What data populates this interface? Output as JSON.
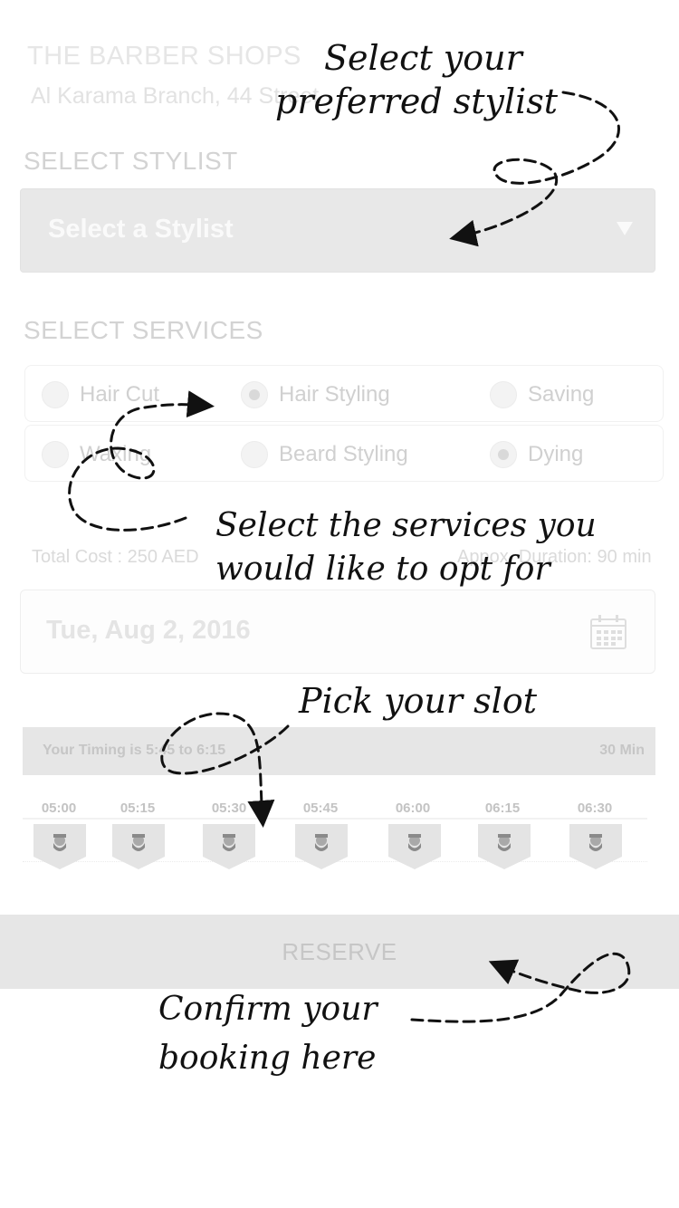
{
  "shop": {
    "title": "THE BARBER SHOPS",
    "branch": "Al Karama Branch, 44 Street"
  },
  "stylist": {
    "section_label": "SELECT STYLIST",
    "placeholder": "Select a Stylist",
    "caret_icon": "dropdown-caret-icon"
  },
  "services": {
    "section_label": "SELECT SERVICES",
    "rows": [
      [
        {
          "label": "Hair Cut",
          "selected": false
        },
        {
          "label": "Hair Styling",
          "selected": true
        },
        {
          "label": "Saving",
          "selected": false
        }
      ],
      [
        {
          "label": "Waxing",
          "selected": false
        },
        {
          "label": "Beard Styling",
          "selected": false
        },
        {
          "label": "Dying",
          "selected": true
        }
      ]
    ]
  },
  "summary": {
    "total_cost": "Total Cost : 250 AED",
    "duration": "Appox. Duration: 90 min"
  },
  "date": {
    "value": "Tue, Aug 2, 2016",
    "icon": "calendar-icon"
  },
  "timing": {
    "text": "Your Timing is 5:45 to 6:15",
    "length": "30 Min"
  },
  "slots": {
    "times": [
      "05:00",
      "05:15",
      "05:30",
      "05:45",
      "06:00",
      "06:15",
      "06:30"
    ],
    "icon": "barber-avatar-icon"
  },
  "reserve": {
    "label": "RESERVE"
  },
  "annotations": {
    "stylist_line1": "Select your",
    "stylist_line2": "preferred stylist",
    "services_line1": "Select the services you",
    "services_line2": "would like to opt for",
    "slot": "Pick your slot",
    "confirm_line1": "Confirm your",
    "confirm_line2": "booking here"
  },
  "colors": {
    "panel_gray": "#e6e6e6",
    "faded_text": "#d0d0d0",
    "annotation_ink": "#111111"
  }
}
